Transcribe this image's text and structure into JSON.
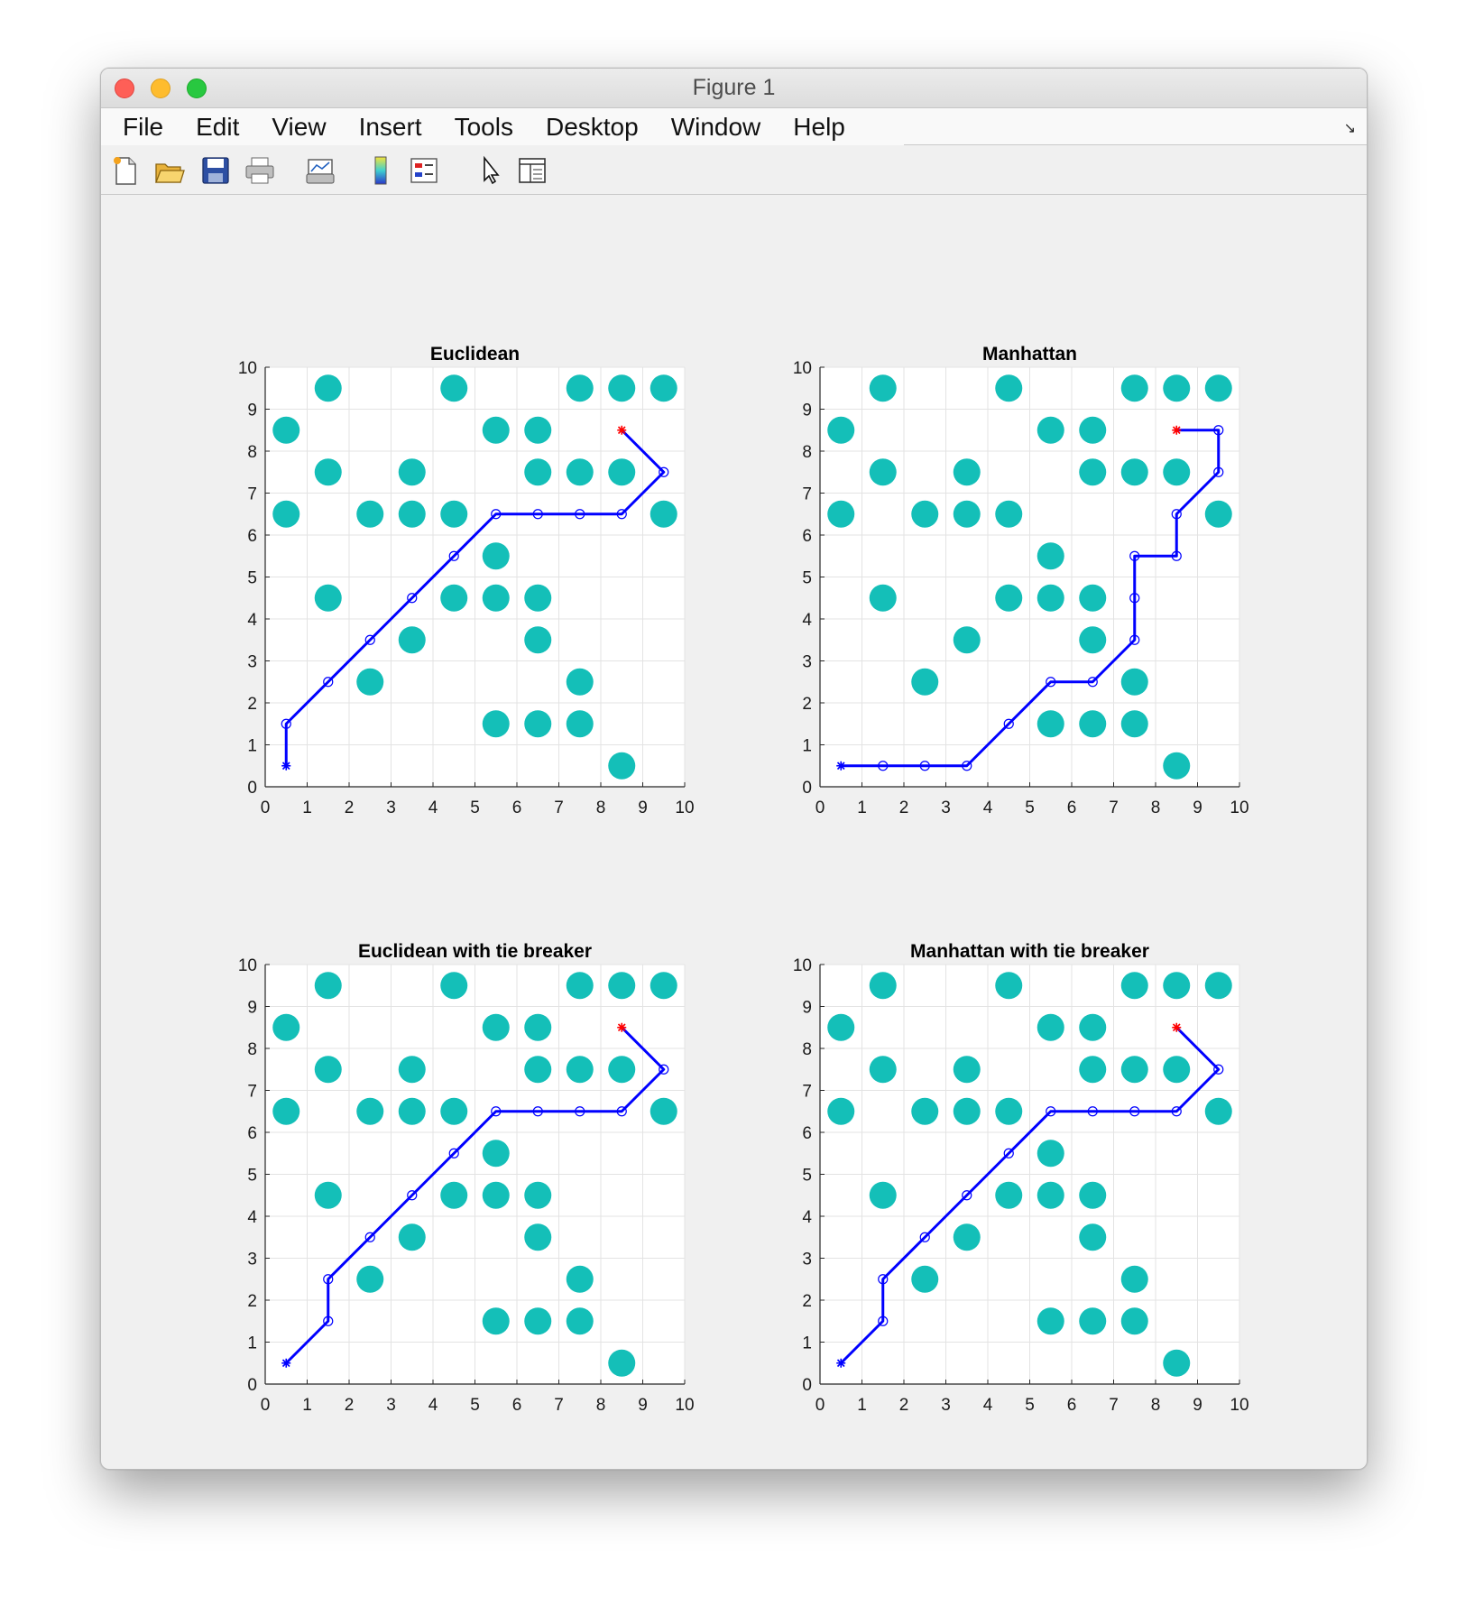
{
  "window": {
    "title": "Figure 1"
  },
  "menu": [
    "File",
    "Edit",
    "View",
    "Insert",
    "Tools",
    "Desktop",
    "Window",
    "Help"
  ],
  "toolbar": [
    {
      "icon": "new-figure-icon"
    },
    {
      "icon": "open-file-icon"
    },
    {
      "icon": "save-icon"
    },
    {
      "icon": "print-icon"
    },
    {
      "icon": "link-plot-icon"
    },
    {
      "icon": "colorbar-icon"
    },
    {
      "icon": "legend-icon"
    },
    {
      "icon": "pointer-icon"
    },
    {
      "icon": "property-inspector-icon"
    }
  ],
  "colors": {
    "obstacle": "#14bfb8",
    "path": "#0000ff",
    "start": "#0000ff",
    "goal": "#ff0000",
    "grid": "#e3e3e3"
  },
  "chart_data": [
    {
      "type": "scatter",
      "title": "Euclidean",
      "xlim": [
        0,
        10
      ],
      "ylim": [
        0,
        10
      ],
      "xticks": [
        "0",
        "1",
        "2",
        "3",
        "4",
        "5",
        "6",
        "7",
        "8",
        "9",
        "10"
      ],
      "yticks": [
        "0",
        "1",
        "2",
        "3",
        "4",
        "5",
        "6",
        "7",
        "8",
        "9",
        "10"
      ],
      "grid": true,
      "obstacles": [
        [
          1.5,
          9.5
        ],
        [
          4.5,
          9.5
        ],
        [
          7.5,
          9.5
        ],
        [
          8.5,
          9.5
        ],
        [
          9.5,
          9.5
        ],
        [
          0.5,
          8.5
        ],
        [
          5.5,
          8.5
        ],
        [
          6.5,
          8.5
        ],
        [
          1.5,
          7.5
        ],
        [
          3.5,
          7.5
        ],
        [
          6.5,
          7.5
        ],
        [
          7.5,
          7.5
        ],
        [
          8.5,
          7.5
        ],
        [
          0.5,
          6.5
        ],
        [
          2.5,
          6.5
        ],
        [
          3.5,
          6.5
        ],
        [
          4.5,
          6.5
        ],
        [
          9.5,
          6.5
        ],
        [
          5.5,
          5.5
        ],
        [
          1.5,
          4.5
        ],
        [
          4.5,
          4.5
        ],
        [
          5.5,
          4.5
        ],
        [
          6.5,
          4.5
        ],
        [
          3.5,
          3.5
        ],
        [
          6.5,
          3.5
        ],
        [
          2.5,
          2.5
        ],
        [
          7.5,
          2.5
        ],
        [
          5.5,
          1.5
        ],
        [
          6.5,
          1.5
        ],
        [
          7.5,
          1.5
        ],
        [
          8.5,
          0.5
        ]
      ],
      "path": [
        [
          0.5,
          0.5
        ],
        [
          0.5,
          1.5
        ],
        [
          1.5,
          2.5
        ],
        [
          2.5,
          3.5
        ],
        [
          3.5,
          4.5
        ],
        [
          4.5,
          5.5
        ],
        [
          5.5,
          6.5
        ],
        [
          6.5,
          6.5
        ],
        [
          7.5,
          6.5
        ],
        [
          8.5,
          6.5
        ],
        [
          9.5,
          7.5
        ],
        [
          8.5,
          8.5
        ]
      ],
      "start": [
        0.5,
        0.5
      ],
      "goal": [
        8.5,
        8.5
      ]
    },
    {
      "type": "scatter",
      "title": "Manhattan",
      "xlim": [
        0,
        10
      ],
      "ylim": [
        0,
        10
      ],
      "xticks": [
        "0",
        "1",
        "2",
        "3",
        "4",
        "5",
        "6",
        "7",
        "8",
        "9",
        "10"
      ],
      "yticks": [
        "0",
        "1",
        "2",
        "3",
        "4",
        "5",
        "6",
        "7",
        "8",
        "9",
        "10"
      ],
      "grid": true,
      "obstacles": [
        [
          1.5,
          9.5
        ],
        [
          4.5,
          9.5
        ],
        [
          7.5,
          9.5
        ],
        [
          8.5,
          9.5
        ],
        [
          9.5,
          9.5
        ],
        [
          0.5,
          8.5
        ],
        [
          5.5,
          8.5
        ],
        [
          6.5,
          8.5
        ],
        [
          1.5,
          7.5
        ],
        [
          3.5,
          7.5
        ],
        [
          6.5,
          7.5
        ],
        [
          7.5,
          7.5
        ],
        [
          8.5,
          7.5
        ],
        [
          0.5,
          6.5
        ],
        [
          2.5,
          6.5
        ],
        [
          3.5,
          6.5
        ],
        [
          4.5,
          6.5
        ],
        [
          9.5,
          6.5
        ],
        [
          5.5,
          5.5
        ],
        [
          1.5,
          4.5
        ],
        [
          4.5,
          4.5
        ],
        [
          5.5,
          4.5
        ],
        [
          6.5,
          4.5
        ],
        [
          3.5,
          3.5
        ],
        [
          6.5,
          3.5
        ],
        [
          2.5,
          2.5
        ],
        [
          7.5,
          2.5
        ],
        [
          5.5,
          1.5
        ],
        [
          6.5,
          1.5
        ],
        [
          7.5,
          1.5
        ],
        [
          8.5,
          0.5
        ]
      ],
      "path": [
        [
          0.5,
          0.5
        ],
        [
          1.5,
          0.5
        ],
        [
          2.5,
          0.5
        ],
        [
          3.5,
          0.5
        ],
        [
          4.5,
          1.5
        ],
        [
          5.5,
          2.5
        ],
        [
          6.5,
          2.5
        ],
        [
          7.5,
          3.5
        ],
        [
          7.5,
          4.5
        ],
        [
          7.5,
          5.5
        ],
        [
          8.5,
          5.5
        ],
        [
          8.5,
          6.5
        ],
        [
          9.5,
          7.5
        ],
        [
          9.5,
          8.5
        ],
        [
          8.5,
          8.5
        ]
      ],
      "start": [
        0.5,
        0.5
      ],
      "goal": [
        8.5,
        8.5
      ]
    },
    {
      "type": "scatter",
      "title": "Euclidean with tie breaker",
      "xlim": [
        0,
        10
      ],
      "ylim": [
        0,
        10
      ],
      "xticks": [
        "0",
        "1",
        "2",
        "3",
        "4",
        "5",
        "6",
        "7",
        "8",
        "9",
        "10"
      ],
      "yticks": [
        "0",
        "1",
        "2",
        "3",
        "4",
        "5",
        "6",
        "7",
        "8",
        "9",
        "10"
      ],
      "grid": true,
      "obstacles": [
        [
          1.5,
          9.5
        ],
        [
          4.5,
          9.5
        ],
        [
          7.5,
          9.5
        ],
        [
          8.5,
          9.5
        ],
        [
          9.5,
          9.5
        ],
        [
          0.5,
          8.5
        ],
        [
          5.5,
          8.5
        ],
        [
          6.5,
          8.5
        ],
        [
          1.5,
          7.5
        ],
        [
          3.5,
          7.5
        ],
        [
          6.5,
          7.5
        ],
        [
          7.5,
          7.5
        ],
        [
          8.5,
          7.5
        ],
        [
          0.5,
          6.5
        ],
        [
          2.5,
          6.5
        ],
        [
          3.5,
          6.5
        ],
        [
          4.5,
          6.5
        ],
        [
          9.5,
          6.5
        ],
        [
          5.5,
          5.5
        ],
        [
          1.5,
          4.5
        ],
        [
          4.5,
          4.5
        ],
        [
          5.5,
          4.5
        ],
        [
          6.5,
          4.5
        ],
        [
          3.5,
          3.5
        ],
        [
          6.5,
          3.5
        ],
        [
          2.5,
          2.5
        ],
        [
          7.5,
          2.5
        ],
        [
          5.5,
          1.5
        ],
        [
          6.5,
          1.5
        ],
        [
          7.5,
          1.5
        ],
        [
          8.5,
          0.5
        ]
      ],
      "path": [
        [
          0.5,
          0.5
        ],
        [
          1.5,
          1.5
        ],
        [
          1.5,
          2.5
        ],
        [
          2.5,
          3.5
        ],
        [
          3.5,
          4.5
        ],
        [
          4.5,
          5.5
        ],
        [
          5.5,
          6.5
        ],
        [
          6.5,
          6.5
        ],
        [
          7.5,
          6.5
        ],
        [
          8.5,
          6.5
        ],
        [
          9.5,
          7.5
        ],
        [
          8.5,
          8.5
        ]
      ],
      "start": [
        0.5,
        0.5
      ],
      "goal": [
        8.5,
        8.5
      ]
    },
    {
      "type": "scatter",
      "title": "Manhattan with tie breaker",
      "xlim": [
        0,
        10
      ],
      "ylim": [
        0,
        10
      ],
      "xticks": [
        "0",
        "1",
        "2",
        "3",
        "4",
        "5",
        "6",
        "7",
        "8",
        "9",
        "10"
      ],
      "yticks": [
        "0",
        "1",
        "2",
        "3",
        "4",
        "5",
        "6",
        "7",
        "8",
        "9",
        "10"
      ],
      "grid": true,
      "obstacles": [
        [
          1.5,
          9.5
        ],
        [
          4.5,
          9.5
        ],
        [
          7.5,
          9.5
        ],
        [
          8.5,
          9.5
        ],
        [
          9.5,
          9.5
        ],
        [
          0.5,
          8.5
        ],
        [
          5.5,
          8.5
        ],
        [
          6.5,
          8.5
        ],
        [
          1.5,
          7.5
        ],
        [
          3.5,
          7.5
        ],
        [
          6.5,
          7.5
        ],
        [
          7.5,
          7.5
        ],
        [
          8.5,
          7.5
        ],
        [
          0.5,
          6.5
        ],
        [
          2.5,
          6.5
        ],
        [
          3.5,
          6.5
        ],
        [
          4.5,
          6.5
        ],
        [
          9.5,
          6.5
        ],
        [
          5.5,
          5.5
        ],
        [
          1.5,
          4.5
        ],
        [
          4.5,
          4.5
        ],
        [
          5.5,
          4.5
        ],
        [
          6.5,
          4.5
        ],
        [
          3.5,
          3.5
        ],
        [
          6.5,
          3.5
        ],
        [
          2.5,
          2.5
        ],
        [
          7.5,
          2.5
        ],
        [
          5.5,
          1.5
        ],
        [
          6.5,
          1.5
        ],
        [
          7.5,
          1.5
        ],
        [
          8.5,
          0.5
        ]
      ],
      "path": [
        [
          0.5,
          0.5
        ],
        [
          1.5,
          1.5
        ],
        [
          1.5,
          2.5
        ],
        [
          2.5,
          3.5
        ],
        [
          3.5,
          4.5
        ],
        [
          4.5,
          5.5
        ],
        [
          5.5,
          6.5
        ],
        [
          6.5,
          6.5
        ],
        [
          7.5,
          6.5
        ],
        [
          8.5,
          6.5
        ],
        [
          9.5,
          7.5
        ],
        [
          8.5,
          8.5
        ]
      ],
      "start": [
        0.5,
        0.5
      ],
      "goal": [
        8.5,
        8.5
      ]
    }
  ]
}
